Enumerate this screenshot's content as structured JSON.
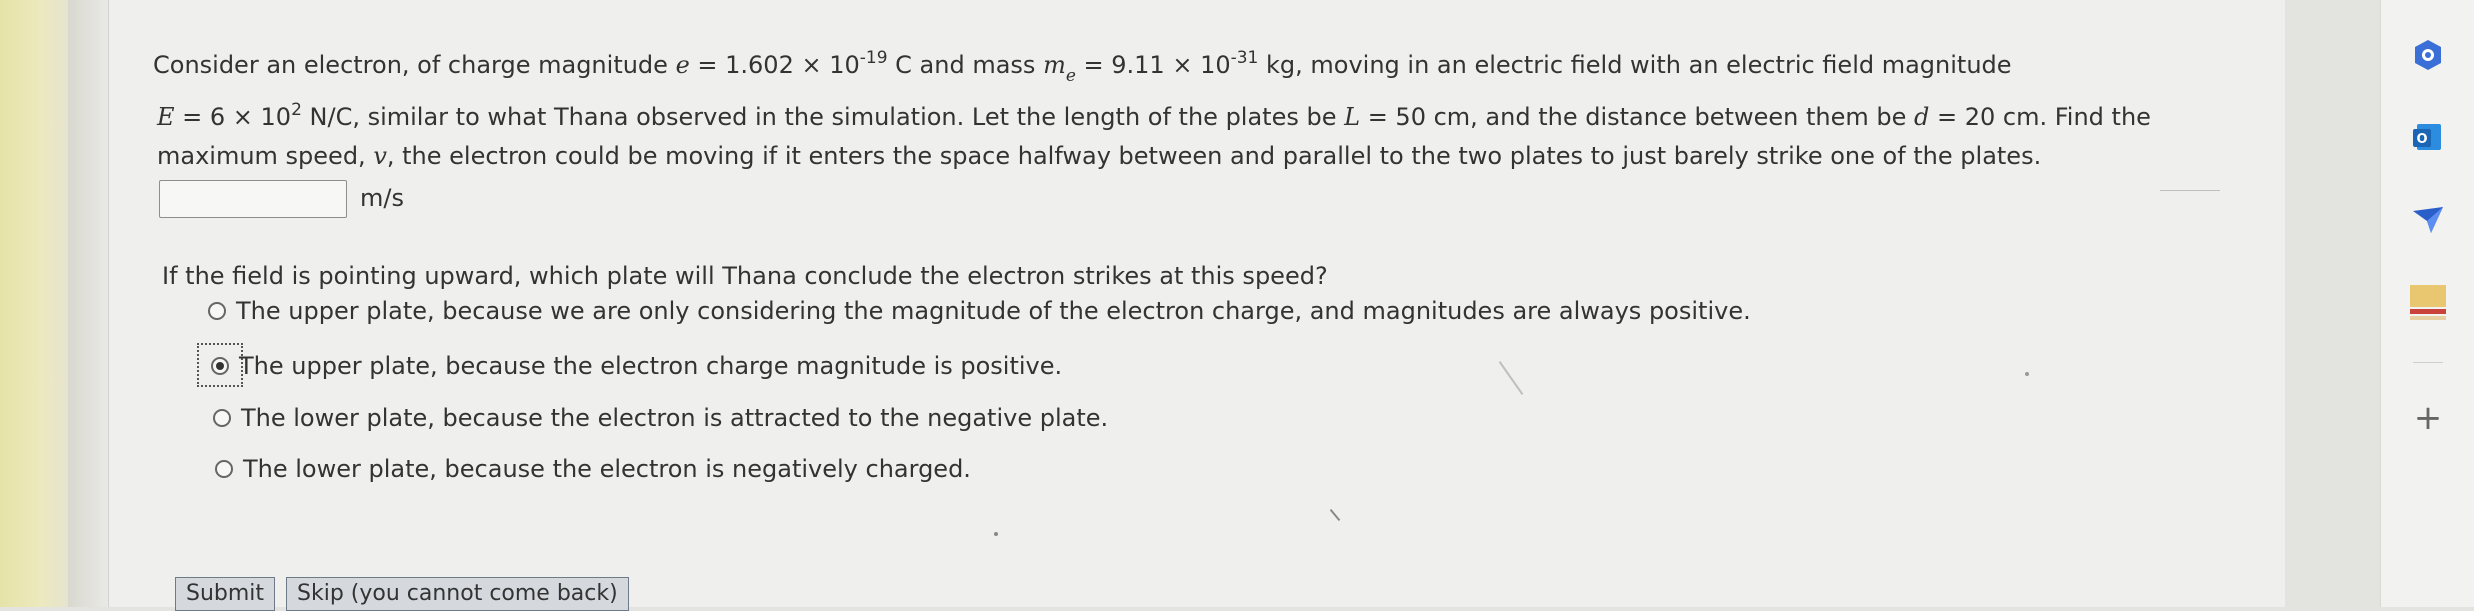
{
  "question": {
    "line1": {
      "t1": "Consider an electron, of charge magnitude ",
      "var_e": "e",
      "t2": " = 1.602 × 10",
      "exp1": "-19",
      "t3": " C and mass ",
      "var_m": "m",
      "sub_e": "e",
      "t4": " = 9.11 × 10",
      "exp2": "-31",
      "t5": " kg, moving in an electric field with an electric field magnitude"
    },
    "line2": {
      "var_E": "E",
      "t1": " = 6 × 10",
      "exp": "2",
      "t2": " N/C, similar to what Thana observed in the simulation. Let the length of the plates be ",
      "var_L": "L",
      "t3": " = 50 cm, and the distance between them be ",
      "var_d": "d",
      "t4": " = 20 cm. Find the"
    },
    "line3": {
      "t1": "maximum speed, ",
      "var_v": "v",
      "t2": ", the electron could be moving if it enters the space halfway between and parallel to the two plates to just barely strike one of the plates."
    },
    "answer_value": "",
    "unit": "m/s"
  },
  "part2": {
    "question": "If the field is pointing upward, which plate will Thana conclude the electron strikes at this speed?",
    "options": [
      {
        "label": "The upper plate, because we are only considering the magnitude of the electron charge, and magnitudes are always positive.",
        "selected": false
      },
      {
        "label": "The upper plate, because the electron charge magnitude is positive.",
        "selected": true
      },
      {
        "label": "The lower plate, because the electron is attracted to the negative plate.",
        "selected": false
      },
      {
        "label": "The lower plate, because the electron is negatively charged.",
        "selected": false
      }
    ]
  },
  "buttons": {
    "submit": "Submit",
    "skip": "Skip (you cannot come back)"
  },
  "sidebar": {
    "icons": [
      "copilot-icon",
      "outlook-icon",
      "send-icon",
      "tools-icon",
      "add-icon"
    ],
    "add_label": "+",
    "outlook_letter": "O"
  },
  "colors": {
    "copilot": "#3a6fd8",
    "outlook": "#1a66b5",
    "send": "#2a5fc9"
  }
}
